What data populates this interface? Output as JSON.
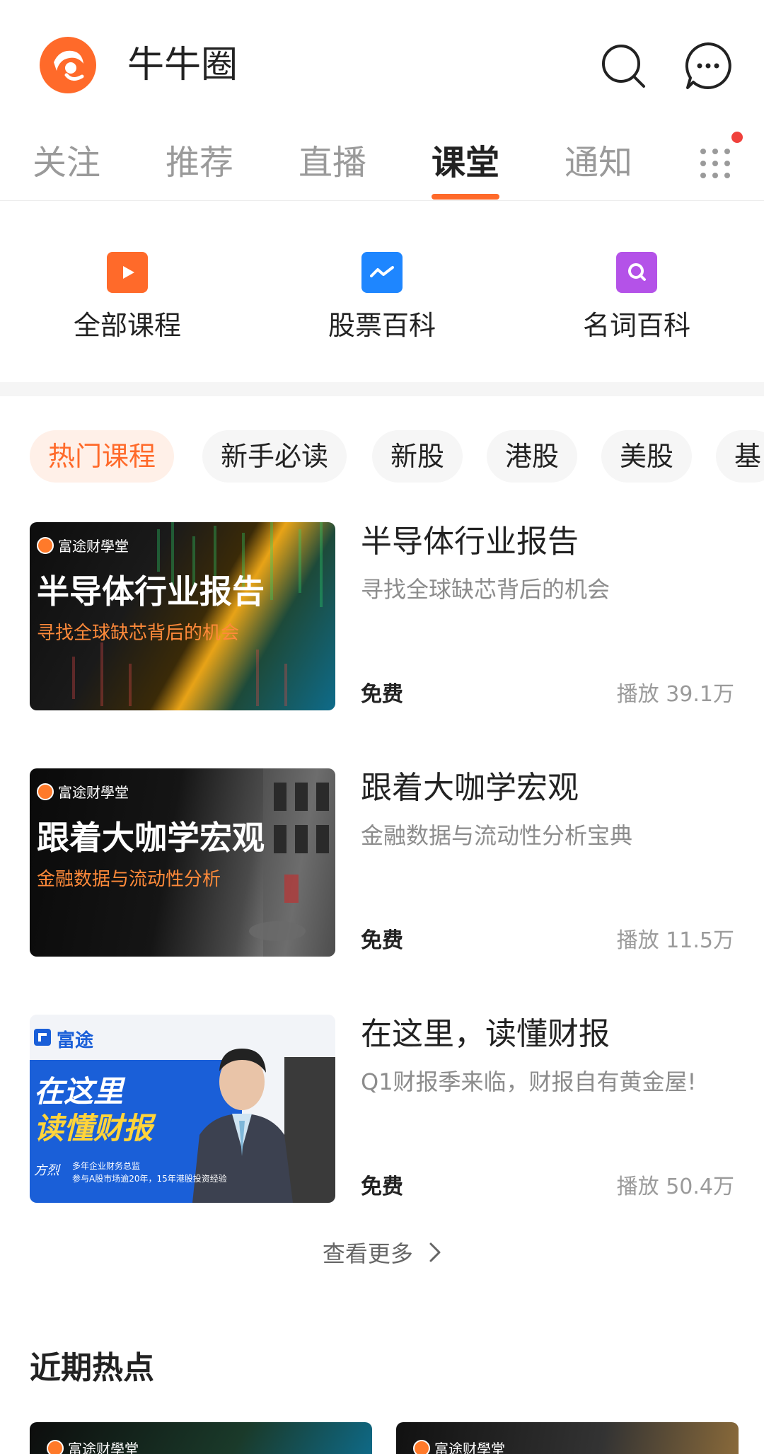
{
  "header": {
    "title": "牛牛圈"
  },
  "tabs": [
    "关注",
    "推荐",
    "直播",
    "课堂",
    "通知"
  ],
  "active_tab": "课堂",
  "shortcuts": [
    {
      "label": "全部课程",
      "icon": "play-tv-icon",
      "color": "#ff6a2a"
    },
    {
      "label": "股票百科",
      "icon": "chart-line-icon",
      "color": "#1e86ff"
    },
    {
      "label": "名词百科",
      "icon": "search-book-icon",
      "color": "#b452e8"
    }
  ],
  "chips": [
    "热门课程",
    "新手必读",
    "新股",
    "港股",
    "美股",
    "基"
  ],
  "active_chip": "热门课程",
  "courses": [
    {
      "title": "半导体行业报告",
      "subtitle": "寻找全球缺芯背后的机会",
      "price": "免费",
      "plays": "播放 39.1万",
      "thumb": {
        "brand": "富途财學堂",
        "main": "半导体行业报告",
        "sub": "寻找全球缺芯背后的机会"
      }
    },
    {
      "title": "跟着大咖学宏观",
      "subtitle": "金融数据与流动性分析宝典",
      "price": "免费",
      "plays": "播放 11.5万",
      "thumb": {
        "brand": "富途财學堂",
        "main": "跟着大咖学宏观",
        "sub": "金融数据与流动性分析"
      }
    },
    {
      "title": "在这里，读懂财报",
      "subtitle": "Q1财报季来临，财报自有黄金屋!",
      "price": "免费",
      "plays": "播放 50.4万",
      "thumb": {
        "brand": "富途",
        "main1": "在这里",
        "main2": "读懂财报",
        "person": "方烈",
        "desc1": "多年企业财务总监",
        "desc2": "参与A股市场逾20年，15年港股投资经验"
      }
    }
  ],
  "see_more": "查看更多",
  "section_title": "近期热点",
  "hot_cards": [
    {
      "brand": "富途财學堂"
    },
    {
      "brand": "富途财學堂"
    }
  ],
  "colors": {
    "accent": "#ff6a2a",
    "badge": "#f0413c"
  }
}
